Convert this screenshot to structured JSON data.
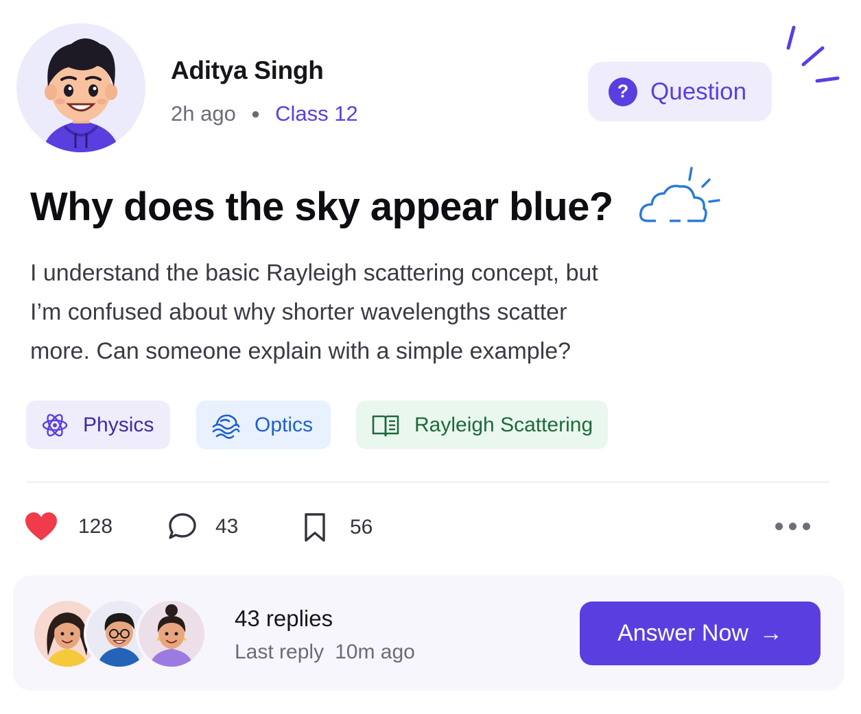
{
  "author": {
    "name": "Aditya Singh",
    "posted_ago": "2h ago",
    "class_label": "Class 12"
  },
  "badge": {
    "label": "Question"
  },
  "post": {
    "title": "Why does the sky appear blue?",
    "body_lines": [
      "I understand the basic Rayleigh scattering concept, but",
      "I’m confused about why shorter wavelengths scatter",
      "more. Can someone explain with a simple example?"
    ]
  },
  "tags": [
    {
      "label": "Physics",
      "icon": "atom-icon"
    },
    {
      "label": "Optics",
      "icon": "waves-icon"
    },
    {
      "label": "Rayleigh Scattering",
      "icon": "book-icon"
    }
  ],
  "actions": {
    "likes": "128",
    "comments": "43",
    "saves": "56"
  },
  "footer": {
    "replies": "43 replies",
    "last_reply_label": "Last reply",
    "last_reply_ago": "10m ago",
    "answer_button": "Answer Now"
  },
  "colors": {
    "accent": "#5b3ee0",
    "like": "#ef3b4a",
    "tag_physics_bg": "#efedfb",
    "tag_optics_bg": "#e8f1fd",
    "tag_rayleigh_bg": "#eaf7ee"
  }
}
